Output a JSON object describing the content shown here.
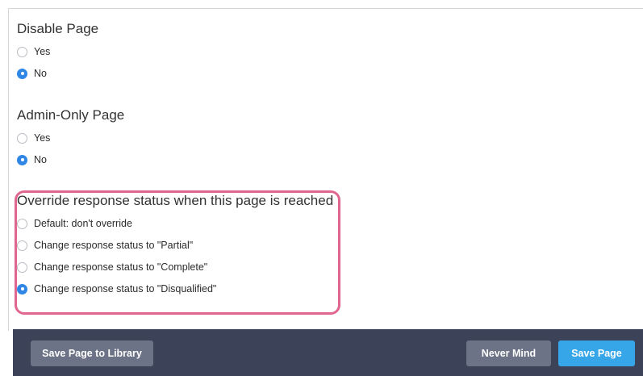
{
  "disable_page": {
    "title": "Disable Page",
    "options": [
      {
        "label": "Yes",
        "selected": false
      },
      {
        "label": "No",
        "selected": true
      }
    ]
  },
  "admin_only_page": {
    "title": "Admin-Only Page",
    "options": [
      {
        "label": "Yes",
        "selected": false
      },
      {
        "label": "No",
        "selected": true
      }
    ]
  },
  "override_status": {
    "title": "Override response status when this page is reached",
    "options": [
      {
        "label": "Default: don't override",
        "selected": false
      },
      {
        "label": "Change response status to \"Partial\"",
        "selected": false
      },
      {
        "label": "Change response status to \"Complete\"",
        "selected": false
      },
      {
        "label": "Change response status to \"Disqualified\"",
        "selected": true
      }
    ]
  },
  "footer": {
    "save_to_library_label": "Save Page to Library",
    "never_mind_label": "Never Mind",
    "save_page_label": "Save Page"
  },
  "colors": {
    "radio_selected": "#2f86e5",
    "highlight_border": "#e0668f",
    "footer_bg": "#3c4359",
    "secondary_button": "#6d7386",
    "primary_button": "#36a6e8"
  }
}
